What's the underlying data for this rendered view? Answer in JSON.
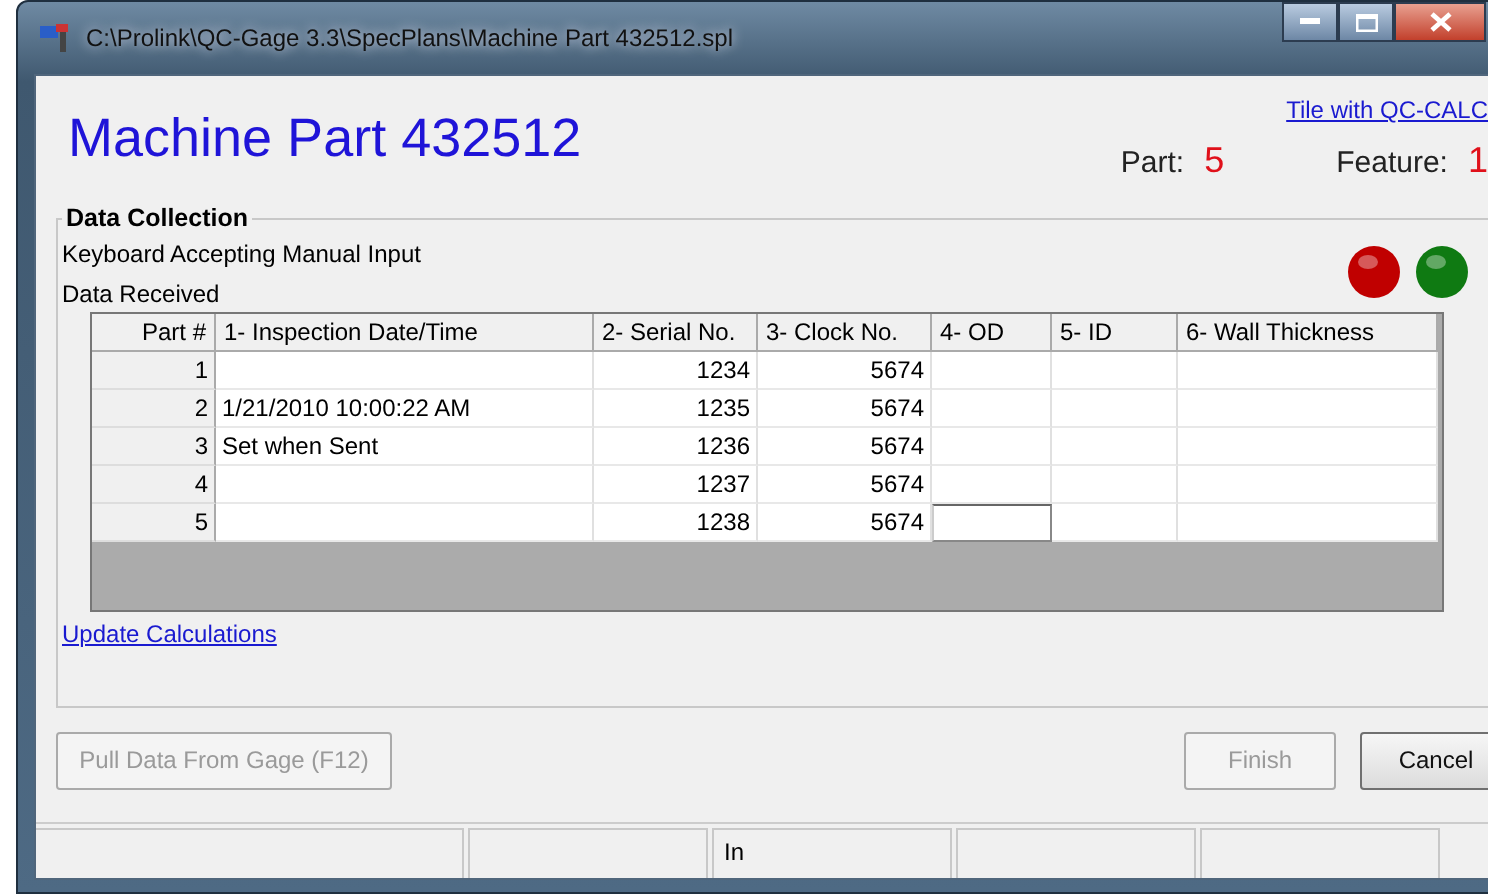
{
  "window": {
    "title": "C:\\Prolink\\QC-Gage 3.3\\SpecPlans\\Machine Part 432512.spl"
  },
  "heading": "Machine Part 432512",
  "tile_link": "Tile with QC-CALC",
  "part": {
    "label": "Part:",
    "value": "5"
  },
  "feature": {
    "label": "Feature:",
    "value": "1"
  },
  "group": {
    "title": "Data Collection",
    "status": "Keyboard Accepting Manual Input",
    "received": "Data Received",
    "lights": [
      {
        "color": "#c00000"
      },
      {
        "color": "#0f7a12"
      }
    ]
  },
  "table": {
    "columns": [
      "Part #",
      "1- Inspection Date/Time",
      "2- Serial No.",
      "3- Clock No.",
      "4- OD",
      "5- ID",
      "6- Wall Thickness"
    ],
    "rows": [
      {
        "cells": [
          "1",
          "",
          "1234",
          "5674",
          "",
          "",
          ""
        ],
        "current": false
      },
      {
        "cells": [
          "2",
          "1/21/2010 10:00:22 AM",
          "1235",
          "5674",
          "",
          "",
          ""
        ],
        "current": false
      },
      {
        "cells": [
          "3",
          "Set when Sent",
          "1236",
          "5674",
          "",
          "",
          ""
        ],
        "current": false
      },
      {
        "cells": [
          "4",
          "",
          "1237",
          "5674",
          "",
          "",
          ""
        ],
        "current": false
      },
      {
        "cells": [
          "5",
          "",
          "1238",
          "5674",
          "",
          "",
          ""
        ],
        "current": true
      }
    ]
  },
  "update_link": "Update Calculations",
  "buttons": [
    {
      "label": "Pull Data From Gage (F12)",
      "disabled": true
    },
    {
      "label": "Finish",
      "disabled": true
    },
    {
      "label": "Cancel",
      "disabled": false
    }
  ],
  "status_bar": {
    "panel_3": "In"
  }
}
